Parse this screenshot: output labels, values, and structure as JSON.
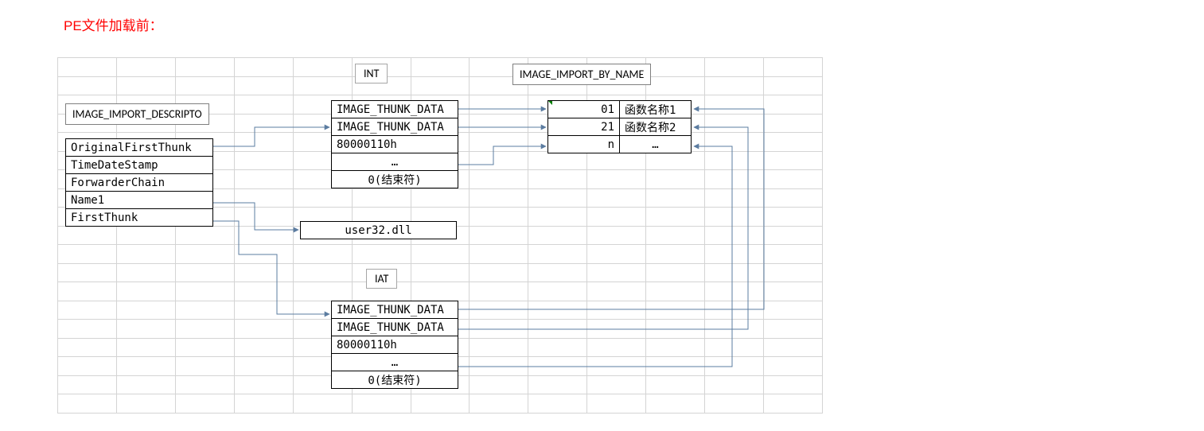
{
  "title": "PE文件加载前：",
  "labels": {
    "descriptor": "IMAGE_IMPORT_DESCRIPTO",
    "int": "INT",
    "iat": "IAT",
    "byname": "IMAGE_IMPORT_BY_NAME"
  },
  "descriptor": {
    "r1": "OriginalFirstThunk",
    "r2": "TimeDateStamp",
    "r3": "ForwarderChain",
    "r4": "Name1",
    "r5": "FirstThunk"
  },
  "int_table": {
    "r1": "IMAGE_THUNK_DATA",
    "r2": "IMAGE_THUNK_DATA",
    "r3": "80000110h",
    "r4": "…",
    "r5": "0(结束符)"
  },
  "dll": "user32.dll",
  "iat_table": {
    "r1": "IMAGE_THUNK_DATA",
    "r2": "IMAGE_THUNK_DATA",
    "r3": "80000110h",
    "r4": "…",
    "r5": "0(结束符)"
  },
  "byname_table": {
    "c1r1": "01",
    "c2r1": "函数名称1",
    "c1r2": "21",
    "c2r2": "函数名称2",
    "c1r3": "n",
    "c2r3": "…"
  }
}
